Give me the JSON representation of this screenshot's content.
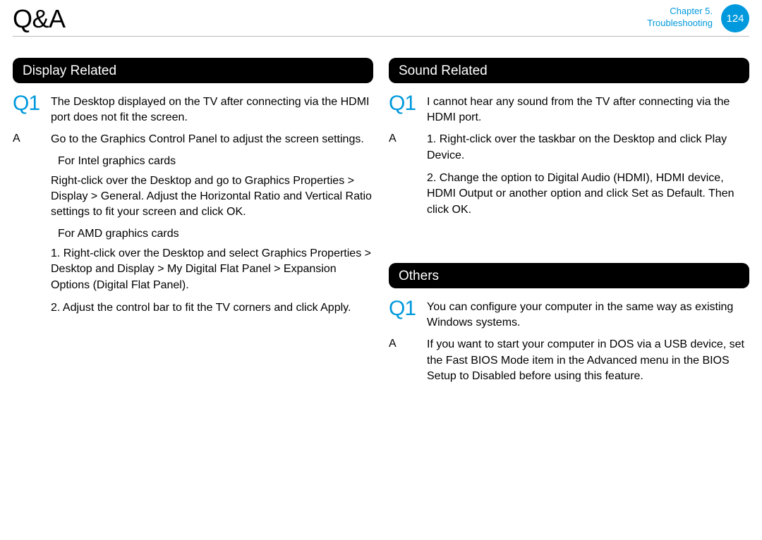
{
  "header": {
    "title": "Q&A",
    "chapter_line1": "Chapter 5.",
    "chapter_line2": "Troubleshooting",
    "page_num": "124"
  },
  "left": {
    "section_title": "Display Related",
    "q1_label": "Q1",
    "q1_text": "The Desktop displayed on the TV after connecting via the HDMI port does not ﬁt the screen.",
    "a_label": "A",
    "a_text": "Go to the Graphics Control Panel to adjust the screen settings.",
    "intel_head": "For Intel graphics cards",
    "intel_body": "Right-click over the Desktop and go to Graphics Properties > Display > General. Adjust the Horizontal Ratio and Vertical Ratio settings to ﬁt your screen and click OK.",
    "amd_head": "For AMD graphics cards",
    "amd_step1": "1. Right-click over the Desktop and select Graphics Properties > Desktop and Display > My Digital Flat Panel > Expansion Options (Digital Flat Panel).",
    "amd_step2": "2. Adjust the control bar to ﬁt the TV corners and click Apply."
  },
  "right": {
    "sound_title": "Sound Related",
    "sq1_label": "Q1",
    "sq1_text": "I cannot hear any sound from the TV after connecting via the HDMI port.",
    "sa_label": "A",
    "sa_step1": "1. Right-click over the taskbar on the Desktop and click Play Device.",
    "sa_step2": "2. Change the option to Digital Audio (HDMI), HDMI device, HDMI Output or another option and click Set as Default. Then click OK.",
    "others_title": "Others",
    "oq1_label": "Q1",
    "oq1_text": "You can conﬁgure your computer in the same way as existing Windows systems.",
    "oa_label": "A",
    "oa_text": "If you want to start your computer in DOS via a USB device, set the Fast BIOS Mode item in the Advanced menu in the BIOS Setup to Disabled before using this feature."
  }
}
